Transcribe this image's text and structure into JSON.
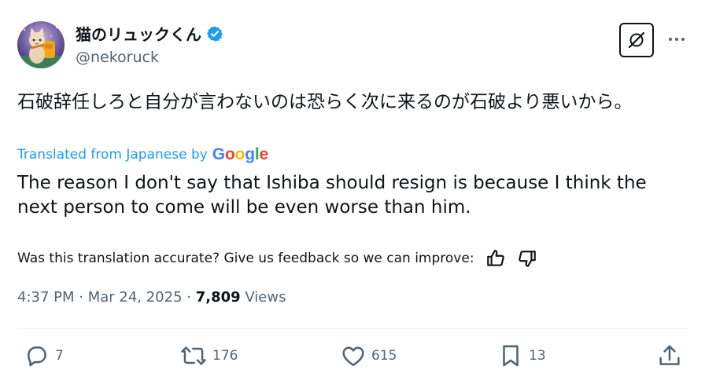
{
  "author": {
    "display_name": "猫のリュックくん",
    "handle": "@nekoruck",
    "avatar_icon": "cat-with-backpack-avatar",
    "verified_icon": "verified-badge-icon"
  },
  "header": {
    "grok_icon": "grok-icon",
    "more_icon": "more-dots-icon"
  },
  "post": {
    "original_text": "石破辞任しろと自分が言わないのは恐らく次に来るのが石破より悪いから。",
    "translated_label": "Translated from Japanese by",
    "google_label": "Google",
    "translated_text": "The reason I don't say that Ishiba should resign is because I think the next person to come will be even worse than him.",
    "feedback_question": "Was this translation accurate? Give us feedback so we can improve:"
  },
  "meta": {
    "time": "4:37 PM",
    "sep1": " · ",
    "date": "Mar 24, 2025",
    "sep2": " · ",
    "views_count": "7,809",
    "views_label": " Views"
  },
  "actions": {
    "replies": "7",
    "reposts": "176",
    "likes": "615",
    "bookmarks": "13"
  },
  "colors": {
    "link_blue": "#1d9bf0",
    "text_primary": "#0f1419",
    "text_secondary": "#536471",
    "verified_blue": "#1d9bf0"
  }
}
